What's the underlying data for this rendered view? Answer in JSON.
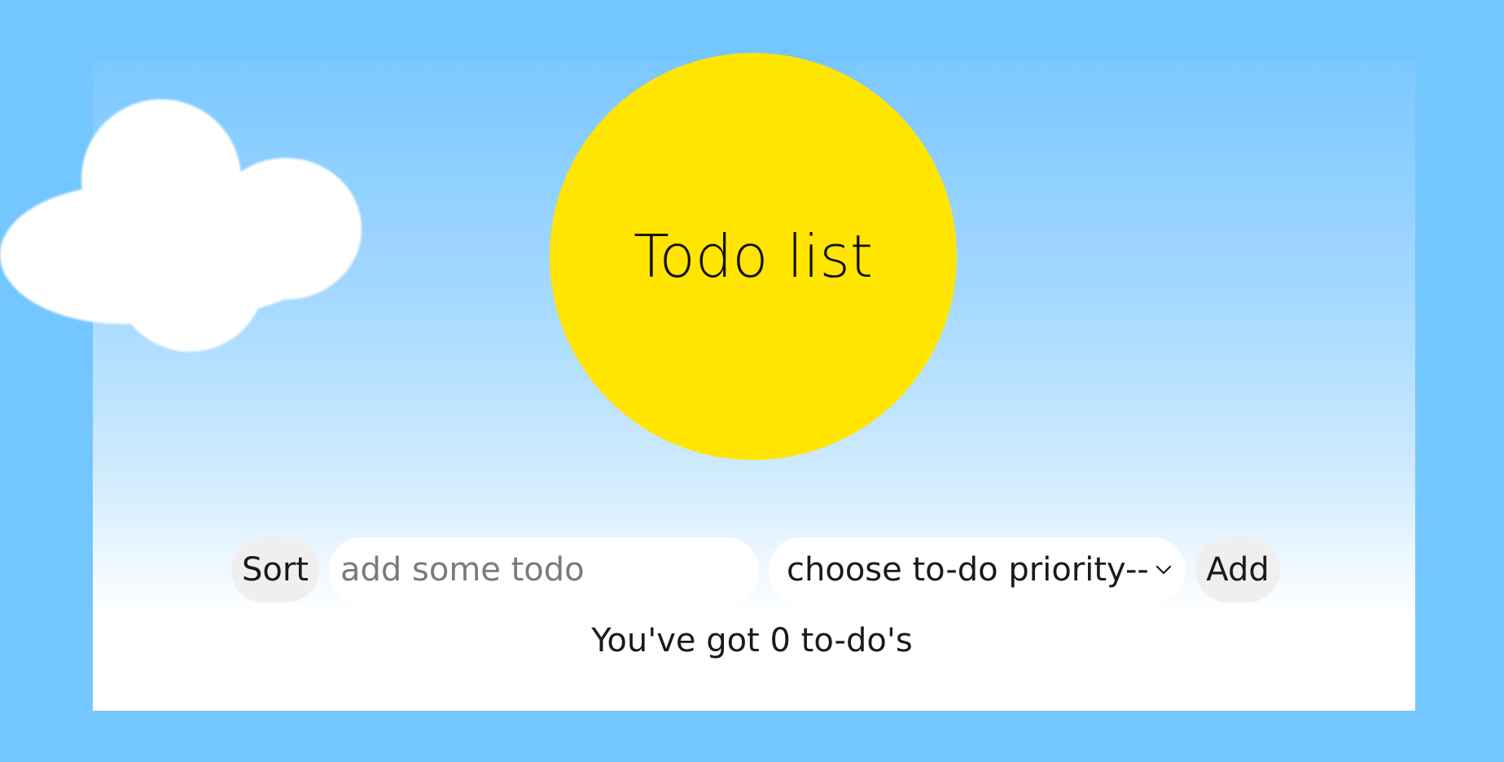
{
  "app": {
    "title": "Todo list"
  },
  "controls": {
    "sort_label": "Sort",
    "todo_input_placeholder": "add some todo",
    "todo_input_value": "",
    "priority_selected": "choose to-do priority--",
    "add_label": "Add"
  },
  "status": {
    "counter_text": "You've got 0 to-do's"
  },
  "colors": {
    "background": "#74c6ff",
    "sun": "#ffe500",
    "button_bg": "#efefef",
    "input_bg": "#ffffff"
  },
  "icons": {
    "cloud": "cloud-icon",
    "sun": "sun-icon",
    "dropdown": "chevron-down-icon"
  }
}
